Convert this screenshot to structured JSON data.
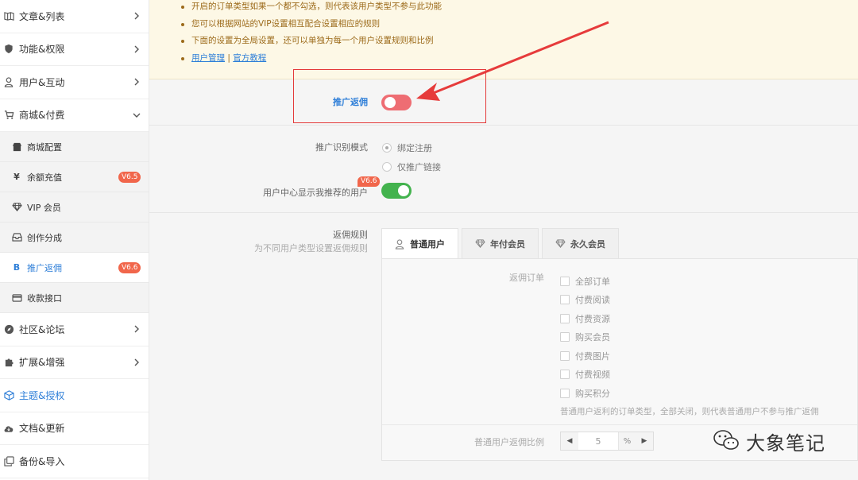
{
  "sidebar": {
    "items": [
      {
        "label": "文章&列表",
        "icon": "book-icon"
      },
      {
        "label": "功能&权限",
        "icon": "shield-icon"
      },
      {
        "label": "用户&互动",
        "icon": "user-icon"
      },
      {
        "label": "商城&付费",
        "icon": "cart-icon"
      }
    ],
    "sub_items": [
      {
        "label": "商城配置",
        "icon": "shop-icon",
        "badge": ""
      },
      {
        "label": "余额充值",
        "icon": "yen-icon",
        "badge": "V6.5"
      },
      {
        "label": "VIP 会员",
        "icon": "diamond-icon",
        "badge": ""
      },
      {
        "label": "创作分成",
        "icon": "inbox-icon",
        "badge": ""
      },
      {
        "label": "推广返佣",
        "icon": "bitcoin-icon",
        "badge": "V6.6"
      },
      {
        "label": "收款接口",
        "icon": "card-icon",
        "badge": ""
      }
    ],
    "items_after": [
      {
        "label": "社区&论坛",
        "icon": "compass-icon"
      },
      {
        "label": "扩展&增强",
        "icon": "puzzle-icon"
      },
      {
        "label": "主题&授权",
        "icon": "cube-icon"
      },
      {
        "label": "文档&更新",
        "icon": "cloud-icon"
      },
      {
        "label": "备份&导入",
        "icon": "copy-icon"
      }
    ]
  },
  "notice": {
    "lines": [
      "开启的订单类型如果一个都不勾选，则代表该用户类型不参与此功能",
      "您可以根据网站的VIP设置相互配合设置相应的规则",
      "下面的设置为全局设置，还可以单独为每一个用户设置规则和比例"
    ],
    "link_user": "用户管理",
    "link_sep": "|",
    "link_docs": "官方教程"
  },
  "settings": {
    "promo_label": "推广返佣",
    "promo_enabled": false,
    "mode_label": "推广识别模式",
    "mode_options": [
      "绑定注册",
      "仅推广链接"
    ],
    "mode_selected": "绑定注册",
    "show_label": "用户中心显示我推荐的用户",
    "show_badge": "V6.6",
    "show_enabled": true,
    "rules_title": "返佣规则",
    "rules_sub": "为不同用户类型设置返佣规则"
  },
  "tabs": [
    {
      "label": "普通用户",
      "icon": "user-icon"
    },
    {
      "label": "年付会员",
      "icon": "diamond-icon"
    },
    {
      "label": "永久会员",
      "icon": "diamond-icon"
    }
  ],
  "panel": {
    "orders_label": "返佣订单",
    "orders": [
      "全部订单",
      "付费阅读",
      "付费资源",
      "购买会员",
      "付费图片",
      "付费视频",
      "购买积分"
    ],
    "hint": "普通用户返利的订单类型，全部关闭，则代表普通用户不参与推广返佣",
    "ratio_label": "普通用户返佣比例",
    "ratio_value": "5",
    "ratio_unit": "%"
  },
  "watermark": {
    "text": "大象笔记",
    "icon": "wechat-icon"
  },
  "colors": {
    "accent": "#2f7fd8",
    "toggle_off": "#ee6d73",
    "toggle_on": "#43b34e",
    "badge": "#f1664b",
    "highlight": "#e43a3a"
  }
}
